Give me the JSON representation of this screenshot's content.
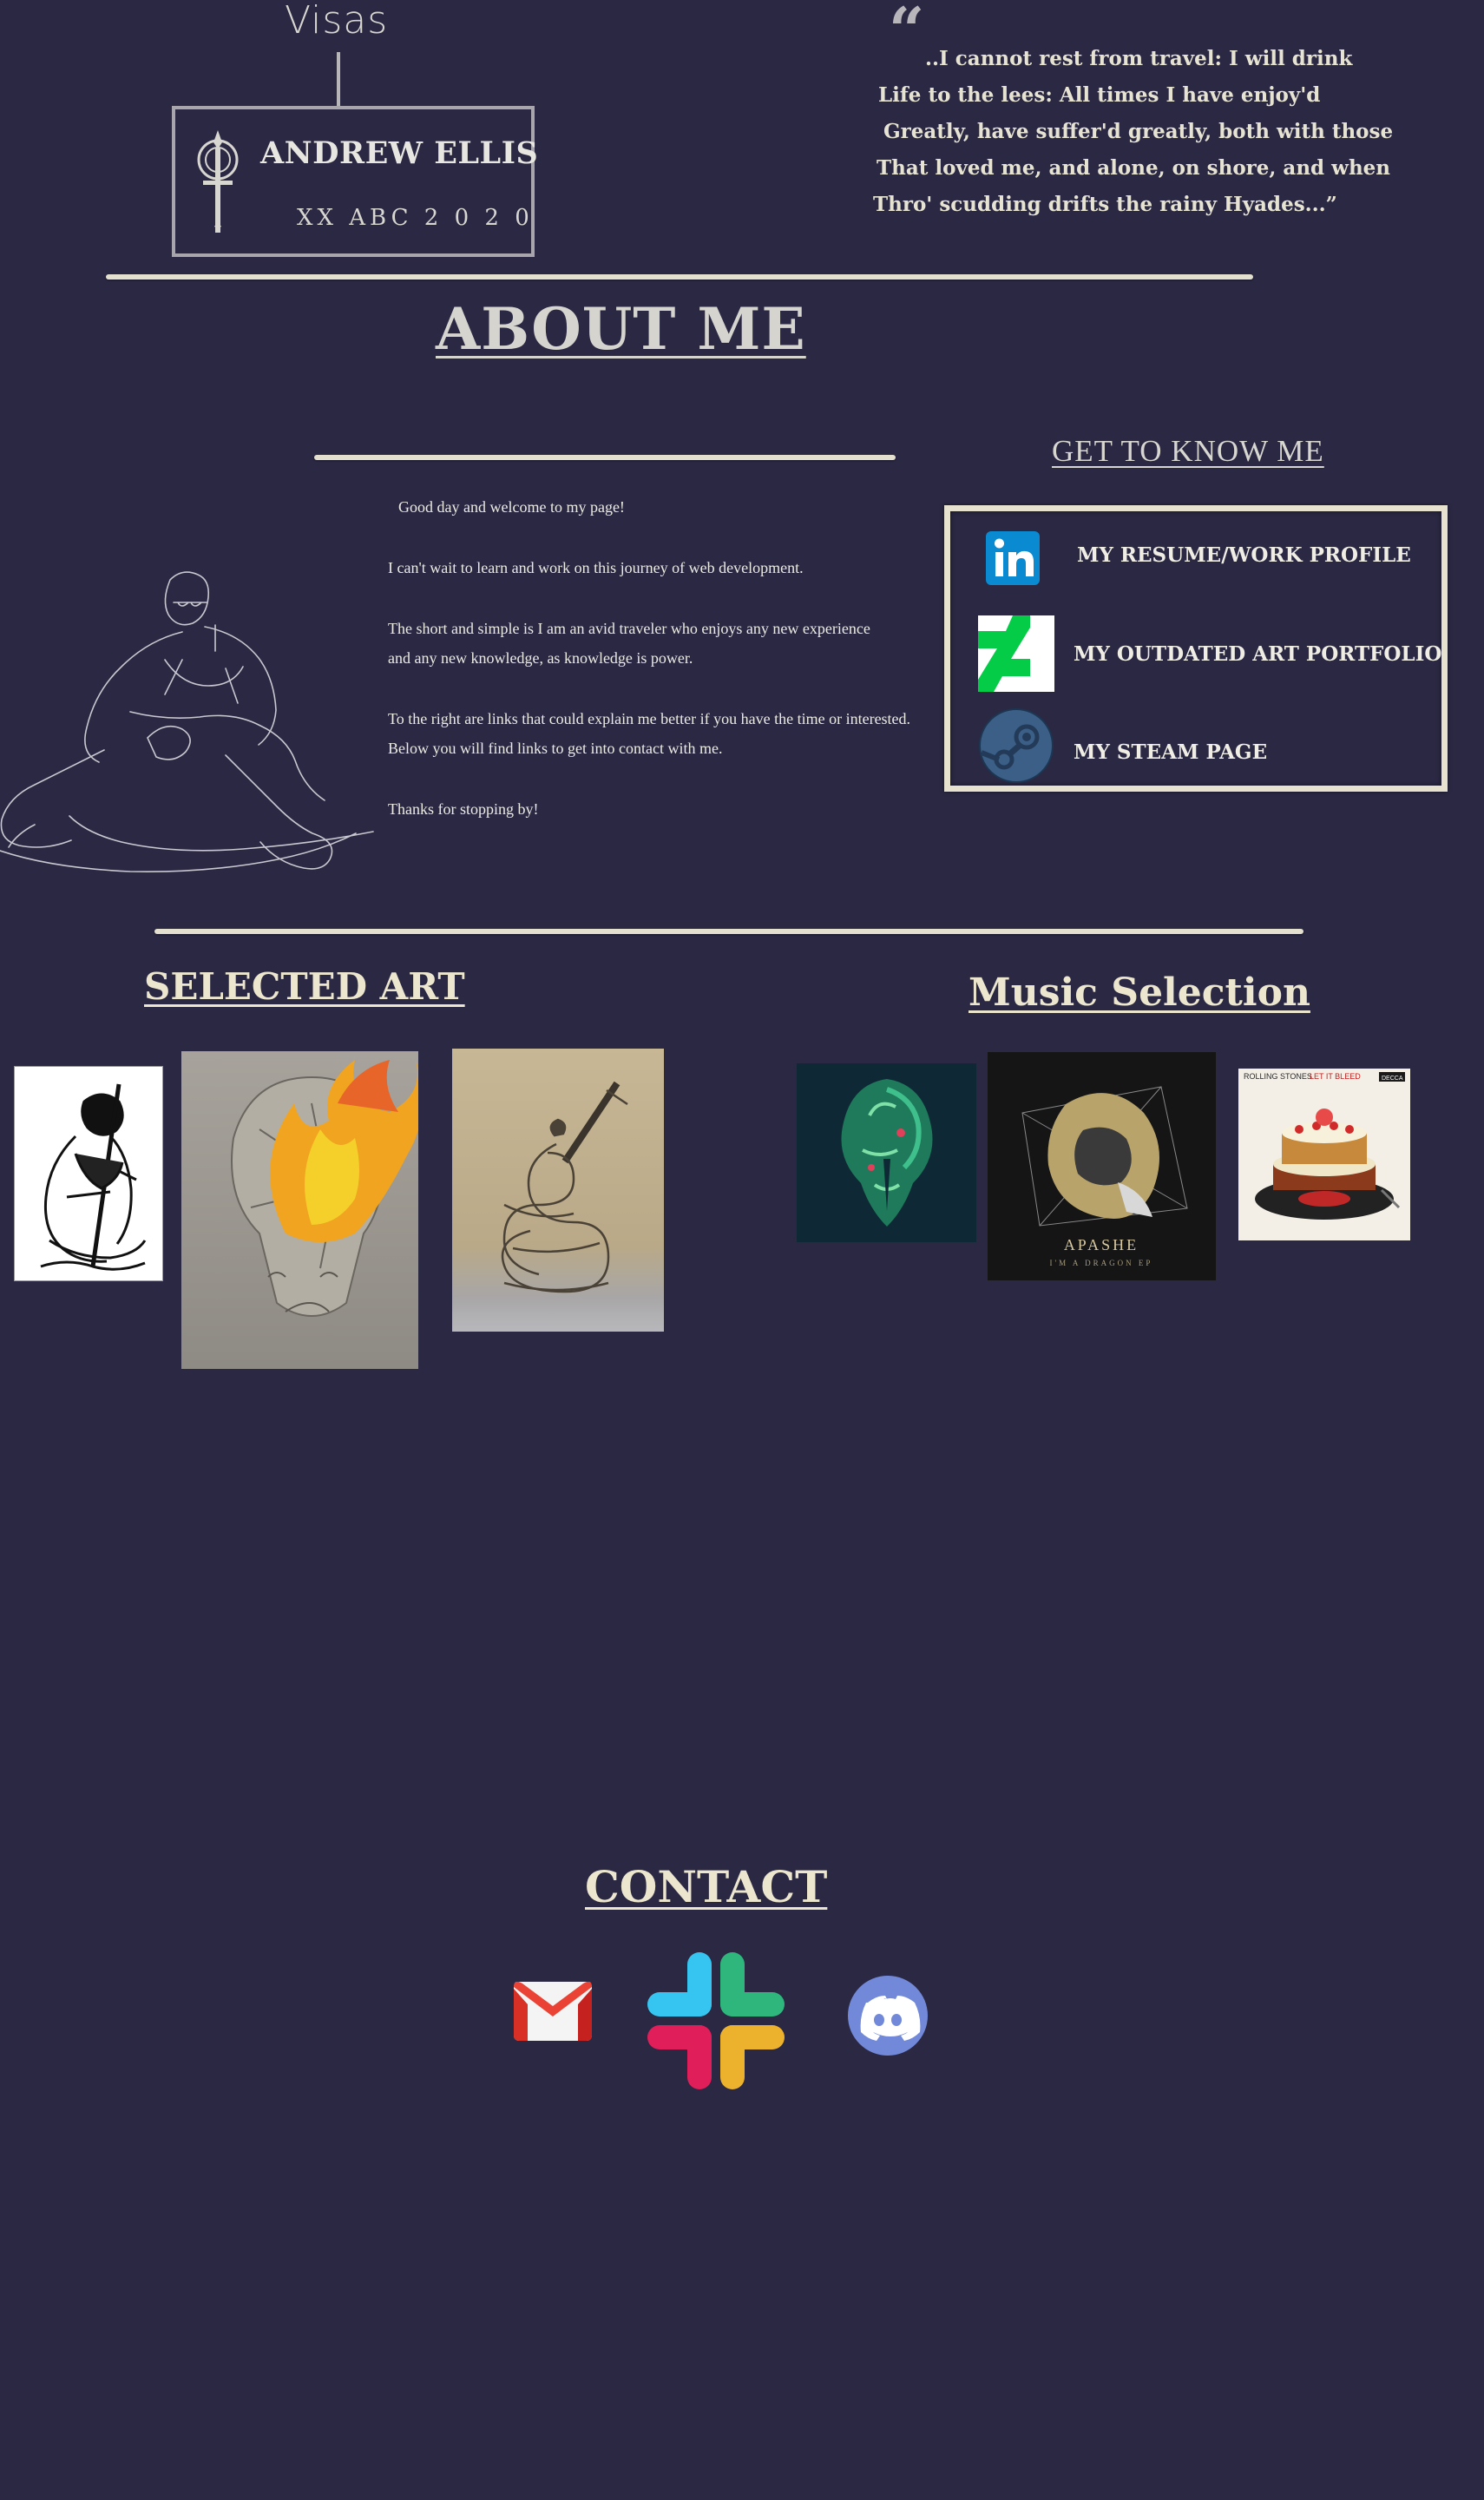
{
  "header": {
    "visas": "Visas",
    "badge_name": "ANDREW ELLIS",
    "badge_sub": "XX ABC 2 0 2 0"
  },
  "quote": {
    "open_mark": "“",
    "lines": [
      "..I cannot rest from travel: I will drink",
      "Life to the lees: All times I have enjoy'd",
      "Greatly, have suffer'd greatly, both with those",
      "That loved me, and alone, on shore, and when",
      "Thro' scudding drifts the rainy Hyades...”"
    ]
  },
  "about": {
    "title": "ABOUT ME",
    "paragraphs": [
      "Good day and welcome to my page!",
      "I can't wait to learn and work on this journey of web development.",
      "The short and simple is I am an avid traveler who enjoys any new experience",
      "and any new knowledge, as knowledge is power.",
      "To the right are links that could explain me better if you have the time or interested.",
      "Below you will find links to get into contact with me.",
      "Thanks for stopping by!"
    ]
  },
  "get_to_know": {
    "title": "GET TO KNOW ME",
    "links": [
      {
        "label": "MY RESUME/WORK PROFILE",
        "icon": "linkedin-icon"
      },
      {
        "label": "MY OUTDATED ART PORTFOLIO",
        "icon": "deviantart-icon"
      },
      {
        "label": "MY STEAM PAGE",
        "icon": "steam-icon"
      }
    ]
  },
  "art": {
    "title": "SELECTED ART",
    "items": [
      "ink-knight-drawing",
      "flaming-skull-painting",
      "snake-dagger-embroidery"
    ]
  },
  "music": {
    "title": "Music Selection",
    "albums": [
      {
        "icon": "green-forest-album-cover"
      },
      {
        "icon": "lion-album-cover",
        "artist": "APASHE",
        "title": "I'M A DRAGON EP"
      },
      {
        "icon": "cake-album-cover",
        "artist": "ROLLING STONES",
        "title": "LET IT BLEED",
        "label": "DECCA"
      }
    ]
  },
  "contact": {
    "title": "CONTACT",
    "icons": [
      "gmail-icon",
      "slack-icon",
      "discord-icon"
    ]
  },
  "colors": {
    "background": "#2a2843",
    "cream": "#e6e2cf",
    "linkedin": "#0a8ad0",
    "deviantart": "#05cc47",
    "discord": "#7289da"
  }
}
